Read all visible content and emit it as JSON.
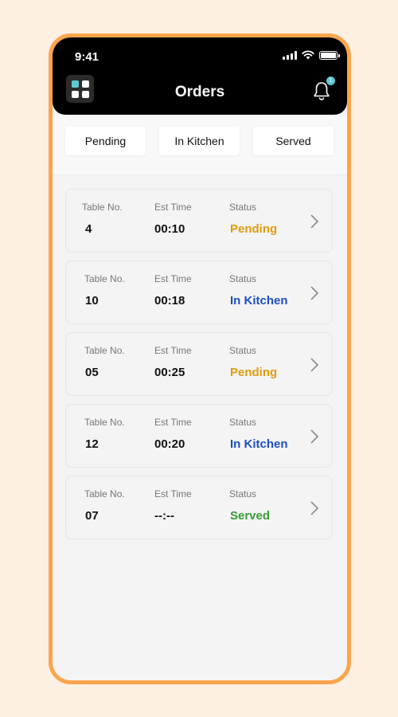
{
  "status_bar": {
    "time": "9:41"
  },
  "header": {
    "title": "Orders",
    "notification_count": "1"
  },
  "tabs": [
    {
      "label": "Pending"
    },
    {
      "label": "In Kitchen"
    },
    {
      "label": "Served"
    }
  ],
  "columns": {
    "table": "Table No.",
    "time": "Est Time",
    "status": "Status"
  },
  "status_colors": {
    "Pending": "#e19b0c",
    "In Kitchen": "#1d4fbf",
    "Served": "#3a9b3a"
  },
  "orders": [
    {
      "table": "4",
      "time": "00:10",
      "status": "Pending"
    },
    {
      "table": "10",
      "time": "00:18",
      "status": "In Kitchen"
    },
    {
      "table": "05",
      "time": "00:25",
      "status": "Pending"
    },
    {
      "table": "12",
      "time": "00:20",
      "status": "In Kitchen"
    },
    {
      "table": "07",
      "time": "--:--",
      "status": "Served"
    }
  ]
}
